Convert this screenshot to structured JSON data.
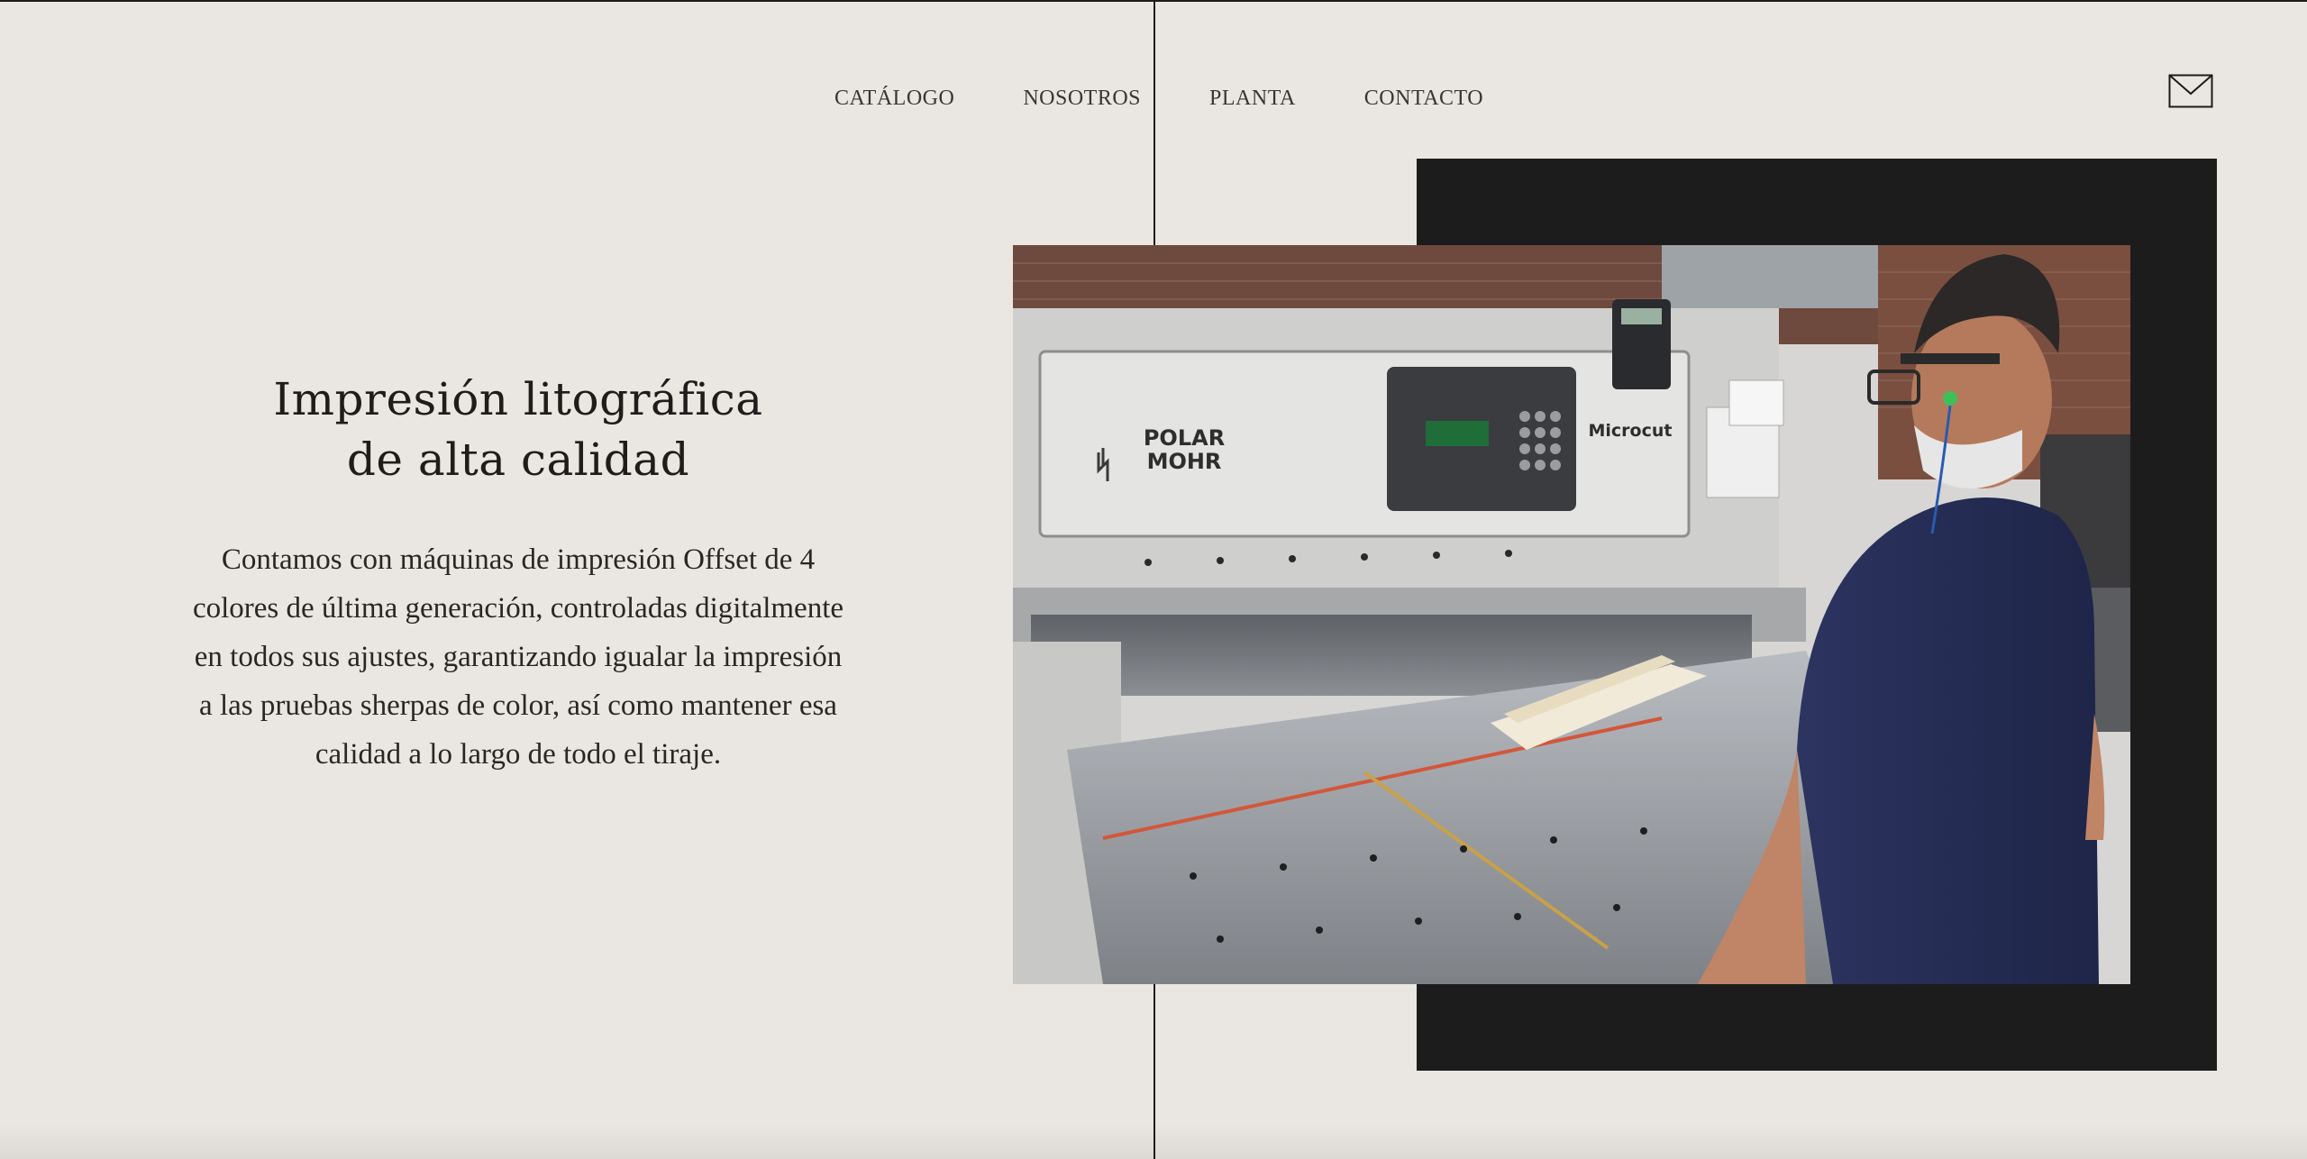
{
  "nav": {
    "items": [
      "CATÁLOGO",
      "NOSOTROS",
      "PLANTA",
      "CONTACTO"
    ]
  },
  "header": {
    "mail_icon": "envelope-icon"
  },
  "hero": {
    "title_line1": "Impresión litográfica",
    "title_line2": "de alta calidad",
    "body": "Contamos con máquinas de impresión Offset de 4 colores de última generación, controladas digitalmente en todos sus ajustes, garantizando igualar la impresión a las pruebas sherpas de color, así como mantener esa calidad a lo largo de todo el tiraje."
  },
  "photo": {
    "machine_brand_line1": "POLAR",
    "machine_brand_line2": "MOHR",
    "machine_model": "Microcut"
  },
  "colors": {
    "background": "#eae6e1",
    "text": "#1d1b1a",
    "frame": "#1c1c1c"
  }
}
